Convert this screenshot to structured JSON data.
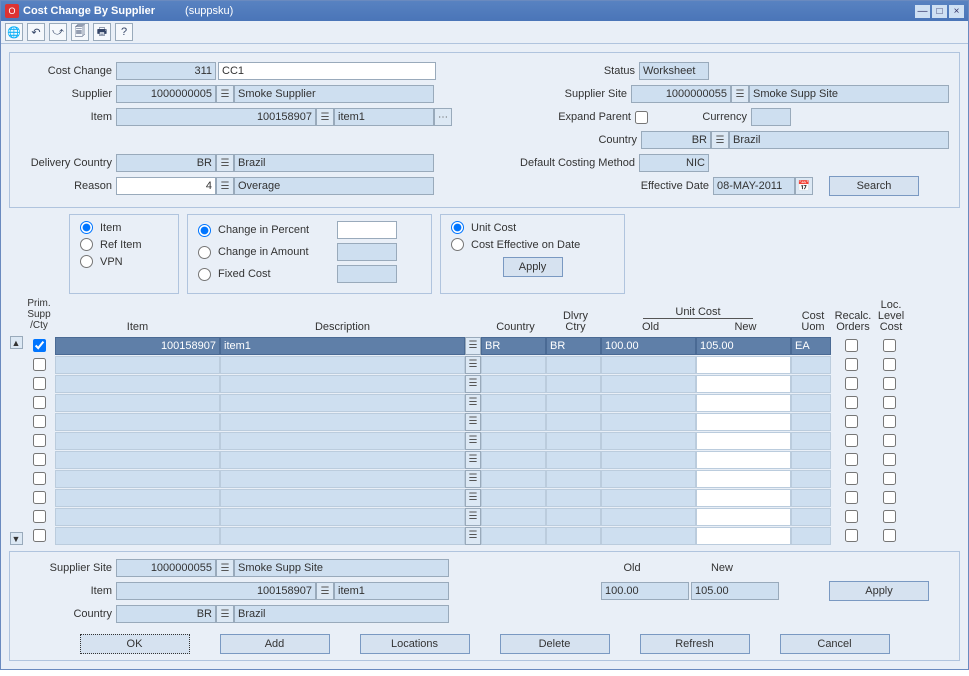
{
  "titlebar": {
    "title": "Cost Change By Supplier",
    "subtitle": "(suppsku)"
  },
  "form": {
    "cost_change_lbl": "Cost Change",
    "cost_change_id": "311",
    "cost_change_desc": "CC1",
    "supplier_lbl": "Supplier",
    "supplier_id": "1000000005",
    "supplier_name": "Smoke Supplier",
    "item_lbl": "Item",
    "item_id": "100158907",
    "item_name": "item1",
    "delivery_country_lbl": "Delivery Country",
    "delivery_country_code": "BR",
    "delivery_country_name": "Brazil",
    "reason_lbl": "Reason",
    "reason_code": "4",
    "reason_name": "Overage",
    "status_lbl": "Status",
    "status_val": "Worksheet",
    "supplier_site_lbl": "Supplier Site",
    "supplier_site_id": "1000000055",
    "supplier_site_name": "Smoke Supp Site",
    "expand_parent_lbl": "Expand Parent",
    "currency_lbl": "Currency",
    "currency_val": "",
    "country_lbl": "Country",
    "country_code": "BR",
    "country_name": "Brazil",
    "dcm_lbl": "Default Costing Method",
    "dcm_val": "NIC",
    "eff_date_lbl": "Effective Date",
    "eff_date_val": "08-MAY-2011",
    "search_btn": "Search"
  },
  "opts": {
    "item": "Item",
    "ref": "Ref Item",
    "vpn": "VPN",
    "pct": "Change in Percent",
    "amt": "Change in Amount",
    "fixed": "Fixed Cost",
    "unit": "Unit Cost",
    "ced": "Cost Effective on Date",
    "pct_val": "",
    "apply": "Apply"
  },
  "grid": {
    "side_label1": "Prim.",
    "side_label2": "Supp",
    "side_label3": "/Cty",
    "hdr_item": "Item",
    "hdr_desc": "Description",
    "hdr_country": "Country",
    "hdr_dlvry": "Dlvry Ctry",
    "hdr_unitcost": "Unit Cost",
    "hdr_old": "Old",
    "hdr_new": "New",
    "hdr_costuom": "Cost Uom",
    "hdr_recalc": "Recalc. Orders",
    "hdr_loc": "Loc. Level Cost",
    "rows": [
      {
        "chk": true,
        "item": "100158907",
        "desc": "item1",
        "country": "BR",
        "dlvry": "BR",
        "old": "100.00",
        "new": "105.00",
        "uom": "EA",
        "recalc": false,
        "loc": false,
        "sel": true
      },
      {
        "chk": false
      },
      {
        "chk": false
      },
      {
        "chk": false
      },
      {
        "chk": false
      },
      {
        "chk": false
      },
      {
        "chk": false
      },
      {
        "chk": false
      },
      {
        "chk": false
      },
      {
        "chk": false
      },
      {
        "chk": false
      }
    ]
  },
  "bottom": {
    "site_lbl": "Supplier Site",
    "site_id": "1000000055",
    "site_name": "Smoke Supp Site",
    "item_lbl": "Item",
    "item_id": "100158907",
    "item_name": "item1",
    "country_lbl": "Country",
    "country_code": "BR",
    "country_name": "Brazil",
    "old_lbl": "Old",
    "old_val": "100.00",
    "new_lbl": "New",
    "new_val": "105.00",
    "apply": "Apply"
  },
  "buttons": {
    "ok": "OK",
    "add": "Add",
    "loc": "Locations",
    "del": "Delete",
    "refresh": "Refresh",
    "cancel": "Cancel"
  }
}
